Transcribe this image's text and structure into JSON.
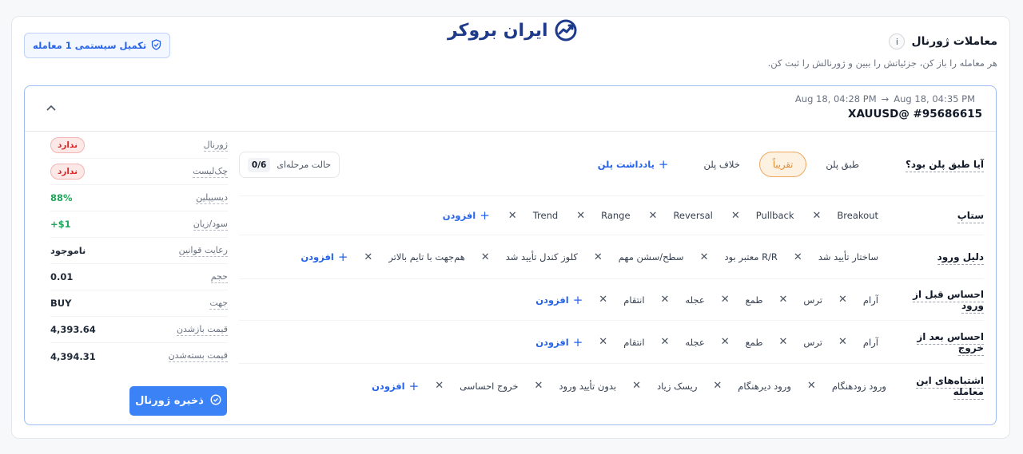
{
  "brand": {
    "logo_text": "ایران بروکر",
    "accent": "#1e3a8a"
  },
  "header": {
    "title": "معاملات ژورنال",
    "subtitle": "هر معامله را باز کن، جزئیاتش را ببین و ژورنالش را ثبت کن.",
    "complete_button": "تکمیل سیستمی 1 معامله"
  },
  "trade": {
    "open_time": "Aug 18, 04:28 PM",
    "close_time": "Aug 18, 04:35 PM",
    "symbol": "XAUUSD@ #95686615"
  },
  "plan": {
    "label": "آیا طبق پلن بود؟",
    "options": [
      "طبق پلن",
      "تقریباً",
      "خلاف پلن"
    ],
    "selected": "تقریباً",
    "note_button": "یادداشت پلن",
    "stage_label": "حالت مرحله‌ای",
    "stage_count": "0/6"
  },
  "rows": [
    {
      "label": "ستاپ",
      "chips": [
        "Breakout",
        "Pullback",
        "Reversal",
        "Range",
        "Trend"
      ],
      "add": "افزودن"
    },
    {
      "label": "دلیل ورود",
      "chips": [
        "ساختار تأیید شد",
        "R/R معتبر بود",
        "سطح/سشن مهم",
        "کلوز کندل تأیید شد",
        "هم‌جهت با تایم بالاتر"
      ],
      "add": "افزودن"
    },
    {
      "label": "احساس قبل از ورود",
      "chips": [
        "آرام",
        "ترس",
        "طمع",
        "عجله",
        "انتقام"
      ],
      "add": "افزودن"
    },
    {
      "label": "احساس بعد از خروج",
      "chips": [
        "آرام",
        "ترس",
        "طمع",
        "عجله",
        "انتقام"
      ],
      "add": "افزودن"
    },
    {
      "label": "اشتباه‌های این معامله",
      "chips": [
        "ورود زودهنگام",
        "ورود دیرهنگام",
        "ریسک زیاد",
        "بدون تأیید ورود",
        "خروج احساسی"
      ],
      "add": "افزودن"
    }
  ],
  "summary": [
    {
      "label": "ژورنال",
      "value": "ندارد",
      "style": "pill"
    },
    {
      "label": "چک‌لیست",
      "value": "ندارد",
      "style": "pill"
    },
    {
      "label": "دیسیپلین",
      "value": "88%",
      "style": "green"
    },
    {
      "label": "سود/زیان",
      "value": "+$1",
      "style": "green"
    },
    {
      "label": "رعایت قوانین",
      "value": "ناموجود",
      "style": "plain"
    },
    {
      "label": "حجم",
      "value": "0.01",
      "style": "plain"
    },
    {
      "label": "جهت",
      "value": "BUY",
      "style": "plain"
    },
    {
      "label": "قیمت بازشدن",
      "value": "4,393.64",
      "style": "plain"
    },
    {
      "label": "قیمت بسته‌شدن",
      "value": "4,394.31",
      "style": "plain"
    }
  ],
  "save_button": "ذخیره ژورنال",
  "colors": {
    "primary": "#3b82f6",
    "selected_orange": "#f0a85f",
    "danger": "#dc2626",
    "success": "#22a55b"
  }
}
